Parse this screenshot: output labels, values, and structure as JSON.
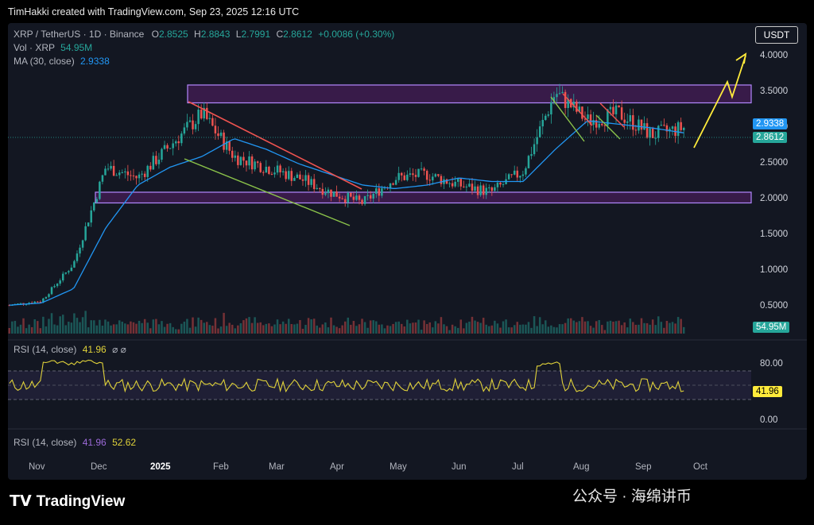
{
  "header": {
    "credit": "TimHakki created with TradingView.com, Sep 23, 2025 12:16 UTC"
  },
  "legend": {
    "symbol": "XRP / TetherUS · 1D · Binance",
    "o_label": "O",
    "o_value": "2.8525",
    "h_label": "H",
    "h_value": "2.8843",
    "l_label": "L",
    "l_value": "2.7991",
    "c_label": "C",
    "c_value": "2.8612",
    "change": "+0.0086 (+0.30%)",
    "vol_label": "Vol · XRP",
    "vol_value": "54.95M",
    "ma_label": "MA (30, close)",
    "ma_value": "2.9338",
    "rsi_label": "RSI (14, close)",
    "rsi_value": "41.96",
    "rsi2_label": "RSI (14, close)",
    "rsi2_value1": "41.96",
    "rsi2_value2": "52.62"
  },
  "currency_button": "USDT",
  "price_ticks": [
    "4.0000",
    "3.5000",
    "3.0000",
    "2.5000",
    "2.0000",
    "1.5000",
    "1.0000",
    "0.5000"
  ],
  "rsi_ticks": [
    "80.00",
    "0.00"
  ],
  "tags": {
    "ma": "2.9338",
    "close": "2.8612",
    "volume": "54.95M",
    "rsi": "41.96"
  },
  "months": [
    "Nov",
    "Dec",
    "2025",
    "Feb",
    "Mar",
    "Apr",
    "May",
    "Jun",
    "Jul",
    "Aug",
    "Sep",
    "Oct"
  ],
  "branding": "TradingView",
  "watermark": "公众号 · 海绵讲币",
  "colors": {
    "up": "#26a69a",
    "down": "#ef5350",
    "ma": "#2196f3",
    "zone": "#9c27b0",
    "rsi": "#e0d23a",
    "projection": "#ffeb3b"
  },
  "chart_data": {
    "type": "line",
    "title": "XRP / TetherUS · 1D · Binance",
    "ylim": [
      0.25,
      4.2
    ],
    "x": [
      "Nov",
      "Nov",
      "Dec",
      "Dec",
      "2025",
      "2025",
      "Feb",
      "Feb",
      "Mar",
      "Mar",
      "Apr",
      "Apr",
      "May",
      "May",
      "Jun",
      "Jun",
      "Jul",
      "Jul",
      "Aug",
      "Aug",
      "Sep",
      "Sep"
    ],
    "series": [
      {
        "name": "",
        "values": [
          0.52,
          0.58,
          1.1,
          2.45,
          2.3,
          2.75,
          3.2,
          2.6,
          2.45,
          2.3,
          2.1,
          1.95,
          2.3,
          2.35,
          2.2,
          2.1,
          2.4,
          3.5,
          3.1,
          3.2,
          2.9,
          3.0
        ]
      },
      {
        "name": "MA (30, close)",
        "values": [
          0.52,
          0.55,
          0.75,
          1.6,
          2.2,
          2.45,
          2.6,
          2.85,
          2.7,
          2.5,
          2.35,
          2.2,
          2.15,
          2.2,
          2.3,
          2.25,
          2.25,
          2.7,
          3.1,
          3.05,
          3.0,
          2.93
        ]
      }
    ],
    "zones": [
      {
        "from": 3.35,
        "to": 3.6
      },
      {
        "from": 1.95,
        "to": 2.1
      }
    ]
  }
}
